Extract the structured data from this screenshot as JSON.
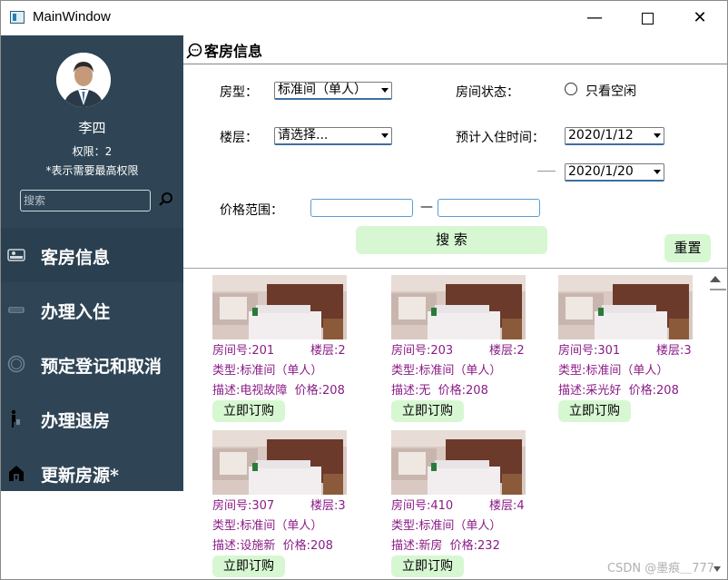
{
  "window": {
    "title": "MainWindow",
    "minimize": "—",
    "close": "✕"
  },
  "sidebar": {
    "user_name": "李四",
    "permission": "权限：2",
    "note": "*表示需要最高权限",
    "search_placeholder": "搜索",
    "nav": [
      {
        "label": "客房信息",
        "icon": "bed-icon"
      },
      {
        "label": "办理入住",
        "icon": "sofa-icon"
      },
      {
        "label": "预定登记和取消",
        "icon": "clock-icon"
      },
      {
        "label": "办理退房",
        "icon": "walking-person-icon"
      },
      {
        "label": "更新房源*",
        "icon": "house-icon"
      }
    ]
  },
  "main": {
    "section_title": "客房信息",
    "filters": {
      "room_type_label": "房型：",
      "room_type_value": "标准间（单人）",
      "room_status_label": "房间状态：",
      "only_free_label": "只看空闲",
      "floor_label": "楼层：",
      "floor_value": "请选择...",
      "checkin_label": "预计入住时间：",
      "date_from": "2020/1/12",
      "date_to": "2020/1/20",
      "price_label": "价格范围：",
      "price_sep": "—",
      "search_label": "搜 索",
      "reset_label": "重置"
    },
    "rooms": [
      {
        "room": "房间号:201",
        "floor": "楼层:2",
        "type": "类型:标准间（单人）",
        "desc": "描述:电视故障",
        "price": "价格:208",
        "buy": "立即订购"
      },
      {
        "room": "房间号:203",
        "floor": "楼层:2",
        "type": "类型:标准间（单人）",
        "desc": "描述:无",
        "price": "价格:208",
        "buy": "立即订购"
      },
      {
        "room": "房间号:301",
        "floor": "楼层:3",
        "type": "类型:标准间（单人）",
        "desc": "描述:采光好",
        "price": "价格:208",
        "buy": "立即订购"
      },
      {
        "room": "房间号:307",
        "floor": "楼层:3",
        "type": "类型:标准间（单人）",
        "desc": "描述:设施新",
        "price": "价格:208",
        "buy": "立即订购"
      },
      {
        "room": "房间号:410",
        "floor": "楼层:4",
        "type": "类型:标准间（单人）",
        "desc": "描述:新房",
        "price": "价格:232",
        "buy": "立即订购"
      }
    ]
  },
  "watermark": "CSDN @墨痕＿777",
  "colors": {
    "sidebar_bg": "#2f4555",
    "accent_green": "#d7f7d2",
    "room_text": "#8a1b86"
  }
}
